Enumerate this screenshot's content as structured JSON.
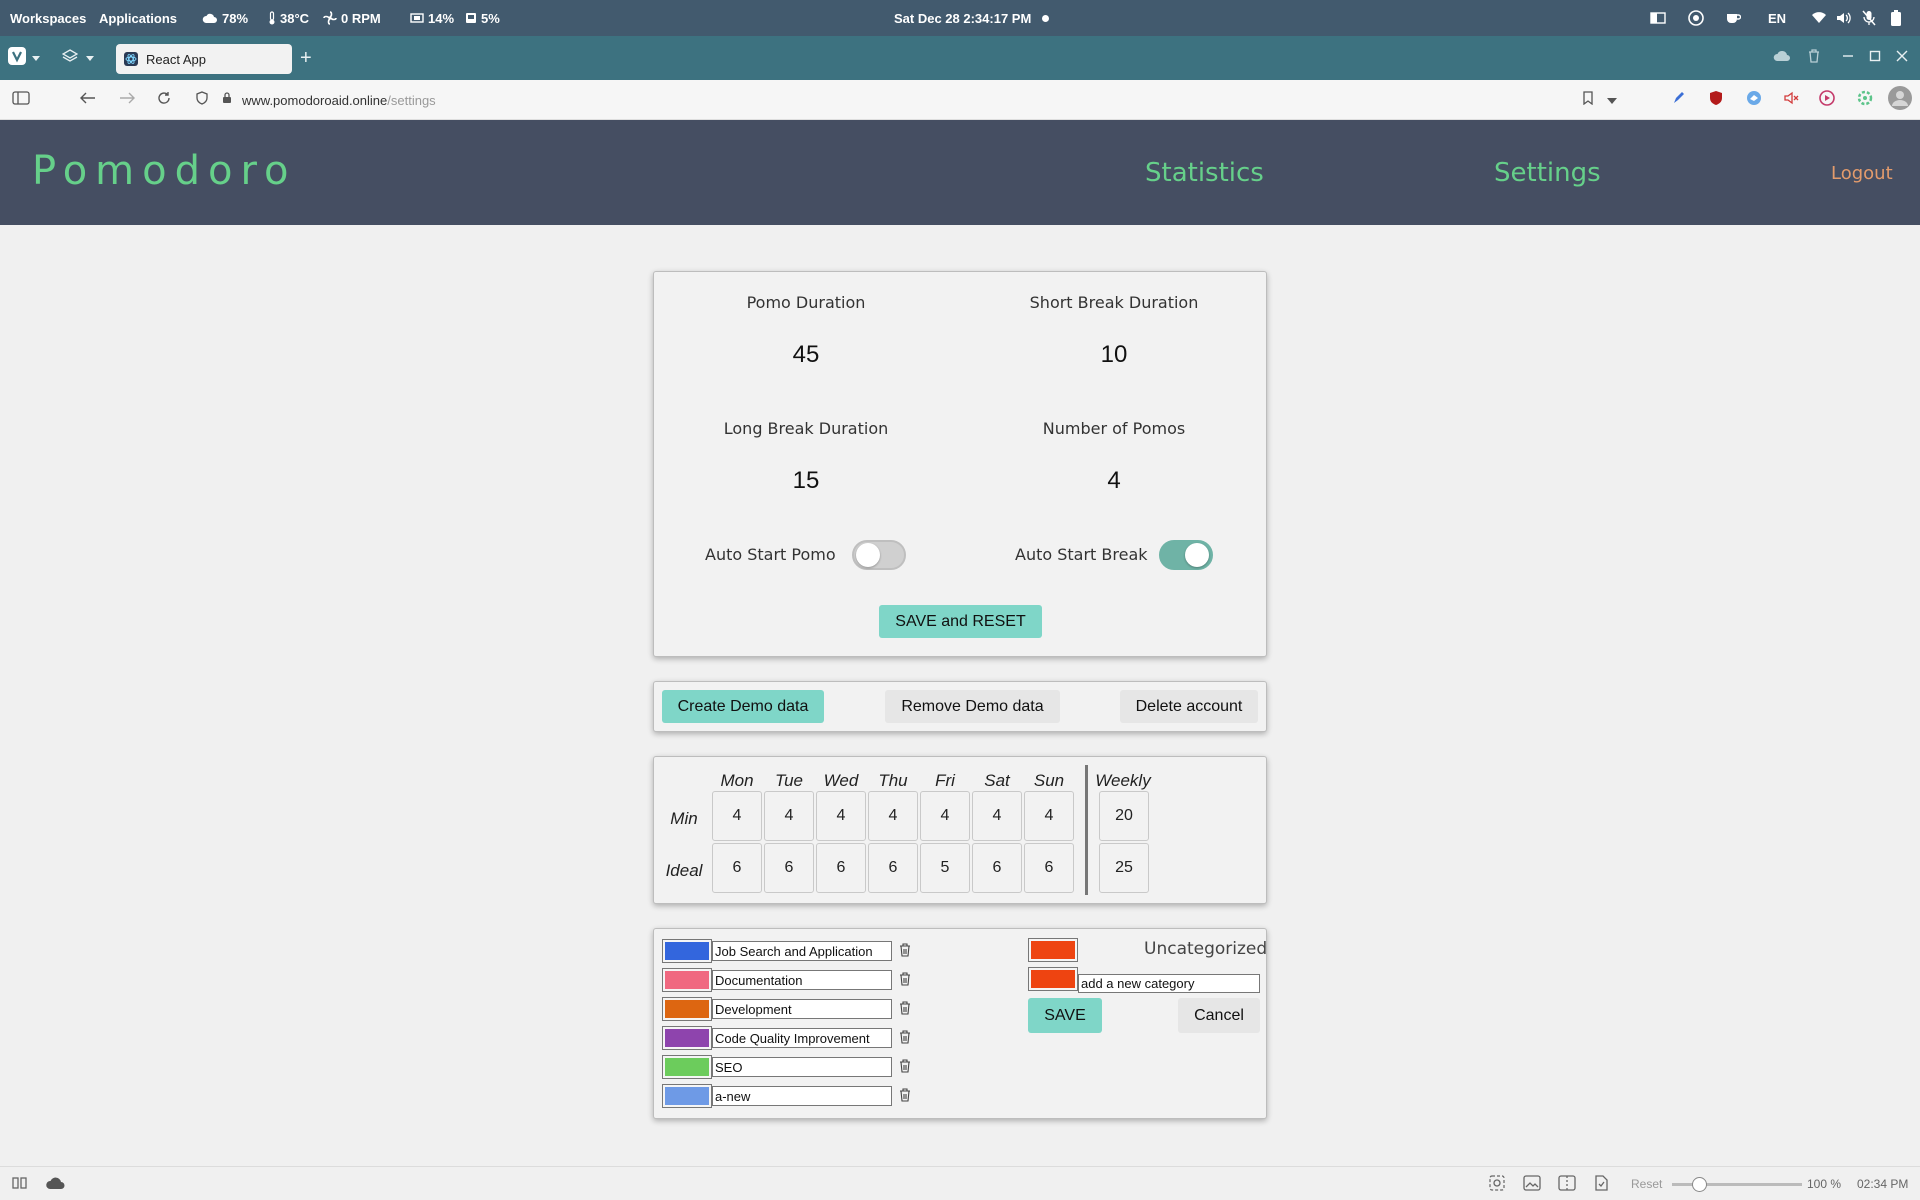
{
  "os_bar": {
    "workspaces": "Workspaces",
    "applications": "Applications",
    "weather": "78%",
    "temperature": "38°C",
    "fan": "0 RPM",
    "cpu": "14%",
    "disk": "5%",
    "clock": "Sat Dec 28   2:34:17 PM",
    "lang": "EN"
  },
  "browser": {
    "tab_title": "React App",
    "url_host": "www.pomodoroaid.online",
    "url_path": "/settings"
  },
  "app": {
    "logo": "Pomodoro",
    "nav_statistics": "Statistics",
    "nav_settings": "Settings",
    "logout": "Logout",
    "accent_color": "#66d08a",
    "header_color": "#454e62"
  },
  "timer_settings": {
    "pomo_label": "Pomo Duration",
    "pomo_value": "45",
    "short_break_label": "Short Break Duration",
    "short_break_value": "10",
    "long_break_label": "Long Break Duration",
    "long_break_value": "15",
    "num_pomos_label": "Number of Pomos",
    "num_pomos_value": "4",
    "auto_start_pomo_label": "Auto Start Pomo",
    "auto_start_pomo_on": false,
    "auto_start_break_label": "Auto Start Break",
    "auto_start_break_on": true,
    "save_reset_label": "SAVE and RESET"
  },
  "account_actions": {
    "create_demo": "Create Demo data",
    "remove_demo": "Remove Demo data",
    "delete_account": "Delete account"
  },
  "goals": {
    "days": [
      "Mon",
      "Tue",
      "Wed",
      "Thu",
      "Fri",
      "Sat",
      "Sun"
    ],
    "weekly_label": "Weekly",
    "min_label": "Min",
    "ideal_label": "Ideal",
    "min_values": [
      "4",
      "4",
      "4",
      "4",
      "4",
      "4",
      "4"
    ],
    "ideal_values": [
      "6",
      "6",
      "6",
      "6",
      "5",
      "6",
      "6"
    ],
    "weekly_min": "20",
    "weekly_ideal": "25"
  },
  "categories": {
    "items": [
      {
        "name": "Job Search and Application",
        "color": "#3366dd"
      },
      {
        "name": "Documentation",
        "color": "#f06880"
      },
      {
        "name": "Development",
        "color": "#dd6611"
      },
      {
        "name": "Code Quality Improvement",
        "color": "#8e44ad"
      },
      {
        "name": "SEO",
        "color": "#6ccc5c"
      },
      {
        "name": "a-new",
        "color": "#6e9ae6"
      }
    ],
    "uncategorized_label": "Uncategorized",
    "uncategorized_color": "#ee4411",
    "new_category_value": "add a new category",
    "new_category_color": "#ee4411",
    "save_label": "SAVE",
    "cancel_label": "Cancel"
  },
  "status_bar": {
    "reset_label": "Reset",
    "zoom": "100 %",
    "time": "02:34 PM"
  }
}
